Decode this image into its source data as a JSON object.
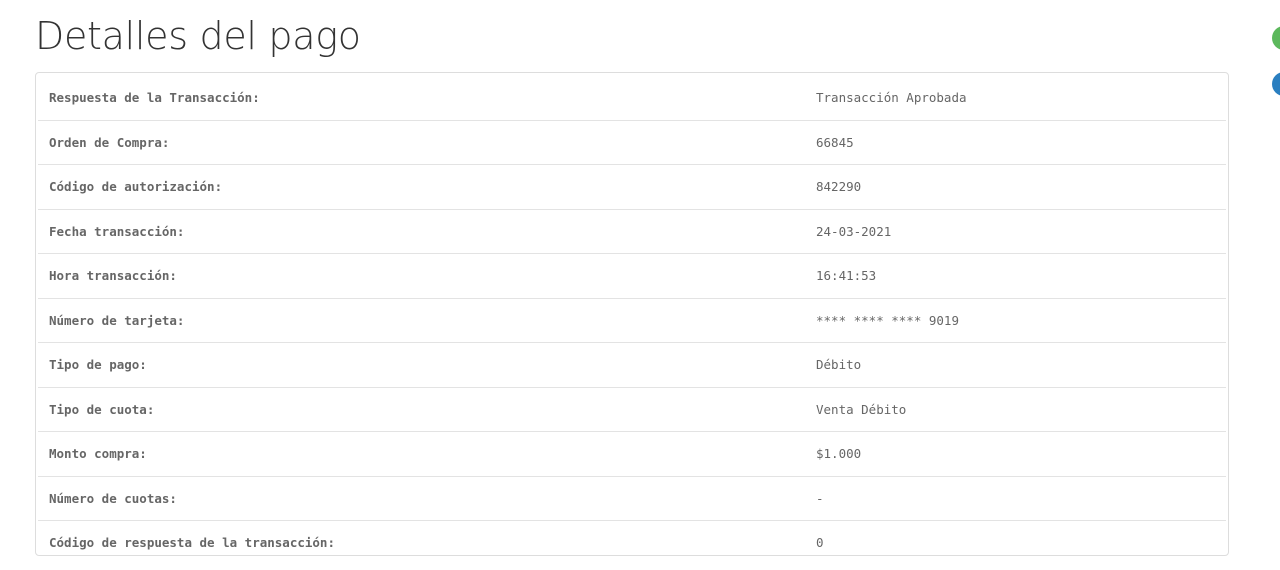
{
  "page": {
    "title": "Detalles del pago"
  },
  "details": {
    "rows": [
      {
        "label": "Respuesta de la Transacción:",
        "value": "Transacción Aprobada"
      },
      {
        "label": "Orden de Compra:",
        "value": "66845"
      },
      {
        "label": "Código de autorización:",
        "value": "842290"
      },
      {
        "label": "Fecha transacción:",
        "value": "24-03-2021"
      },
      {
        "label": "Hora transacción:",
        "value": "16:41:53"
      },
      {
        "label": "Número de tarjeta:",
        "value": "**** **** **** 9019"
      },
      {
        "label": "Tipo de pago:",
        "value": "Débito"
      },
      {
        "label": "Tipo de cuota:",
        "value": "Venta Débito"
      },
      {
        "label": "Monto compra:",
        "value": "$1.000"
      },
      {
        "label": "Número de cuotas:",
        "value": "-"
      },
      {
        "label": "Código de respuesta de la transacción:",
        "value": "0"
      }
    ]
  },
  "colors": {
    "status_green": "#5cb85c",
    "status_blue": "#2a7fc0",
    "title_text": "#333333",
    "table_text": "#666666"
  }
}
